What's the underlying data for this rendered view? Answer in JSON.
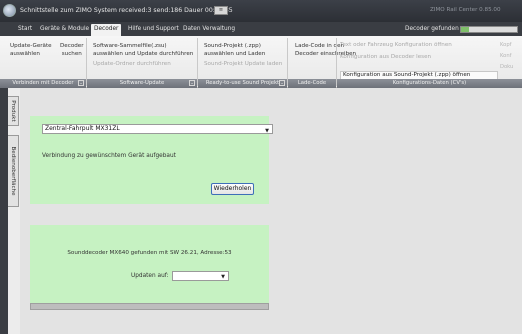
{
  "title_bar": {
    "title": "Schnittstelle zum ZIMO System   received:3  send:186  Dauer 00:00:35",
    "badge": "≡",
    "right_text": "ZIMO Rail Center 0.85.00"
  },
  "menu": {
    "tabs": [
      "Start",
      "Geräte & Module",
      "Decoder",
      "Hilfe und Support",
      "Daten Verwaltung"
    ],
    "active_tab": "Decoder",
    "status_label": "Decoder gefunden",
    "progress_fraction": 0.15
  },
  "ribbon": {
    "update_devices": "Update-Geräte\nauswählen",
    "decoder_search": "Decoder\nsuchen",
    "group_connect": "Verbinden mit Decoder",
    "sw_collection": "Software-Sammelfile(.zsu)\nauswählen und Update durchführen",
    "sw_disabled": "Update-Ordner durchführen",
    "group_sw_update": "Software-Update",
    "sound_project": "Sound-Projekt (.zpp)\nauswählen und Laden",
    "sound_disabled": "Sound-Projekt Update laden",
    "group_sound": "Ready-to-use Sound Projekt",
    "load_code": "Lade-Code in den\nDecoder einschreiben",
    "group_load_code": "Lade-Code",
    "config_dim_1": "Text oder Fahrzeug Konfiguration öffnen",
    "config_dim_2": "Konfiguration aus Decoder lesen",
    "config_sound": "Konfiguration aus Sound-Projekt (.zpp) öffnen",
    "group_config": "Konfigurations-Daten (CV's)",
    "right_dim_1": "Kopf",
    "right_dim_2": "Konf",
    "right_dim_3": "Doku"
  },
  "side_tabs": [
    "Produkt",
    "Bedienoberfläche"
  ],
  "connection_panel": {
    "selected_device": "Zentral-Fahrpult MX31ZL",
    "status_text": "Verbindung zu gewünschtem Gerät aufgebaut",
    "retry_button": "Wiederholen"
  },
  "update_panel": {
    "decoder_info": "Sounddecoder MX640 gefunden mit SW 26.21, Adresse:53",
    "update_label": "Updaten auf:",
    "update_value": ""
  }
}
